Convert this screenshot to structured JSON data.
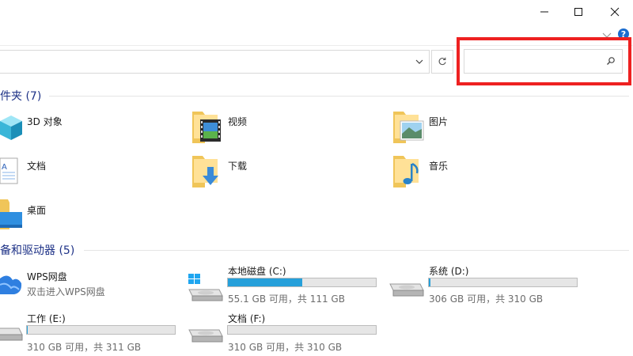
{
  "window": {
    "minimize_icon": "minimize-icon",
    "maximize_icon": "maximize-icon",
    "close_icon": "close-icon",
    "help_label": "?"
  },
  "search": {
    "value": "",
    "placeholder": ""
  },
  "accent_color": "#26a0da",
  "highlight_color": "#ee2121",
  "folders": {
    "title": "件夹 (7)",
    "items": [
      {
        "label": "3D 对象",
        "icon": "3d-objects-folder-icon"
      },
      {
        "label": "视频",
        "icon": "videos-folder-icon"
      },
      {
        "label": "图片",
        "icon": "pictures-folder-icon"
      },
      {
        "label": "文档",
        "icon": "documents-folder-icon"
      },
      {
        "label": "下载",
        "icon": "downloads-folder-icon"
      },
      {
        "label": "音乐",
        "icon": "music-folder-icon"
      },
      {
        "label": "桌面",
        "icon": "desktop-folder-icon"
      }
    ]
  },
  "devices": {
    "title": "备和驱动器 (5)",
    "items": [
      {
        "label": "WPS网盘",
        "sub": "双击进入WPS网盘",
        "icon": "wps-cloud-icon"
      },
      {
        "label": "本地磁盘 (C:)",
        "sub": "55.1 GB 可用，共 111 GB",
        "used_fraction": 0.5,
        "icon": "windows-drive-icon"
      },
      {
        "label": "系统 (D:)",
        "sub": "306 GB 可用，共 310 GB",
        "used_fraction": 0.013,
        "icon": "drive-icon"
      },
      {
        "label": "工作 (E:)",
        "sub": "310 GB 可用，共 311 GB",
        "used_fraction": 0.003,
        "icon": "drive-icon"
      },
      {
        "label": "文档 (F:)",
        "sub": "310 GB 可用，共 310 GB",
        "used_fraction": 0.0,
        "icon": "drive-icon"
      }
    ]
  }
}
